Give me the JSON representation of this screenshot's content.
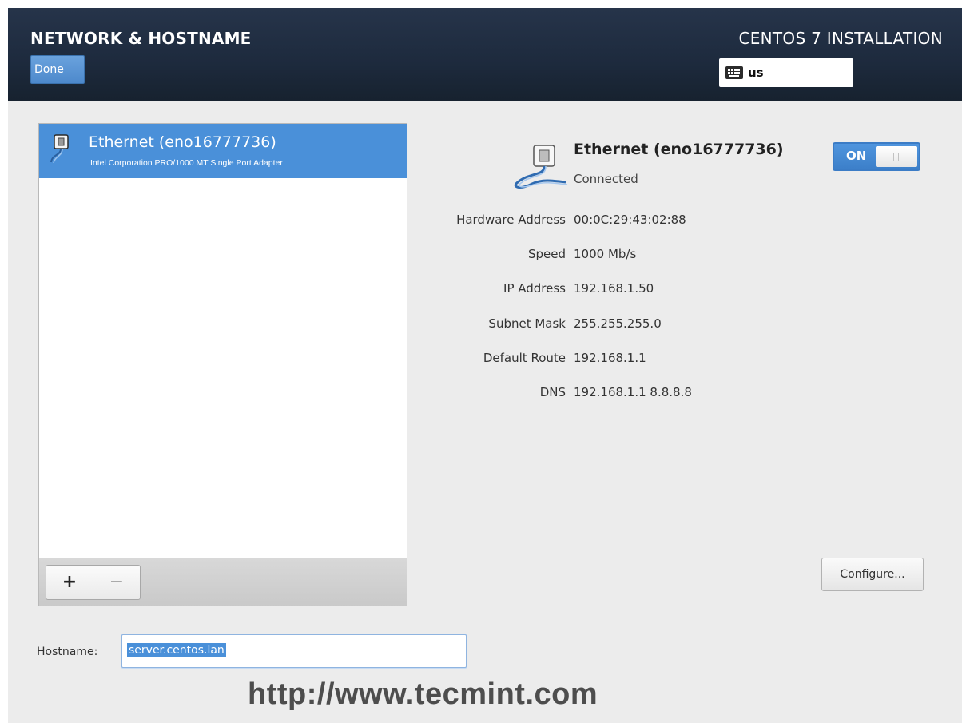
{
  "header": {
    "title": "NETWORK & HOSTNAME",
    "done_label": "Done",
    "install_title": "CENTOS 7 INSTALLATION",
    "keyboard_layout": "us"
  },
  "device_list": {
    "items": [
      {
        "name": "Ethernet (eno16777736)",
        "description": "Intel Corporation PRO/1000 MT Single Port Adapter",
        "selected": true,
        "icon": "ethernet-icon"
      }
    ],
    "add_label": "+",
    "remove_label": "−"
  },
  "details": {
    "name": "Ethernet (eno16777736)",
    "status": "Connected",
    "toggle_label": "ON",
    "toggle_on": true,
    "rows": [
      {
        "label": "Hardware Address",
        "value": "00:0C:29:43:02:88"
      },
      {
        "label": "Speed",
        "value": "1000 Mb/s"
      },
      {
        "label": "IP Address",
        "value": "192.168.1.50"
      },
      {
        "label": "Subnet Mask",
        "value": "255.255.255.0"
      },
      {
        "label": "Default Route",
        "value": "192.168.1.1"
      },
      {
        "label": "DNS",
        "value": "192.168.1.1 8.8.8.8"
      }
    ],
    "configure_label": "Configure..."
  },
  "hostname": {
    "label": "Hostname:",
    "value": "server.centos.lan"
  },
  "watermark": "http://www.tecmint.com",
  "colors": {
    "header_bg": "#1d2a3d",
    "accent": "#4a90d9",
    "background": "#ececec"
  }
}
